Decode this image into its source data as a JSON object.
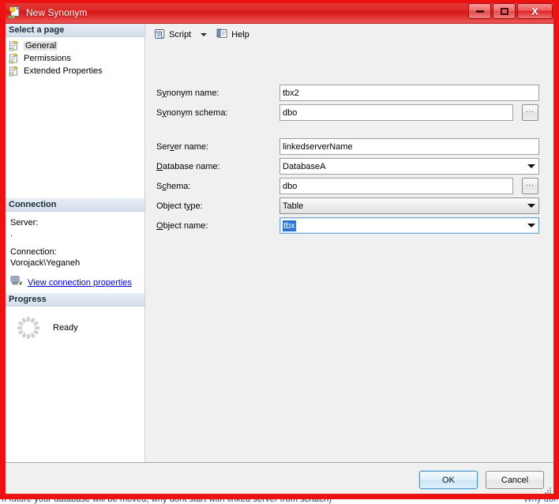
{
  "window": {
    "title": "New Synonym",
    "icon": "synonym-icon",
    "controls": {
      "minimize": "minimize",
      "maximize": "maximize",
      "close": "X"
    }
  },
  "sidebar": {
    "header": "Select a page",
    "items": [
      {
        "label": "General",
        "icon": "page-icon",
        "selected": true
      },
      {
        "label": "Permissions",
        "icon": "page-icon",
        "selected": false
      },
      {
        "label": "Extended Properties",
        "icon": "page-icon",
        "selected": false
      }
    ],
    "connection": {
      "header": "Connection",
      "server_label": "Server:",
      "server_value": ".",
      "connection_label": "Connection:",
      "connection_value": "Vorojack\\Yeganeh",
      "link_text": "View connection properties",
      "link_icon": "server-connection-icon"
    },
    "progress": {
      "header": "Progress",
      "status": "Ready",
      "spinner_icon": "progress-spinner-icon"
    }
  },
  "toolbar": {
    "script_label": "Script",
    "script_icon": "script-icon",
    "script_caret": "chevron-down-icon",
    "help_label": "Help",
    "help_icon": "help-icon"
  },
  "form": {
    "rows": [
      {
        "label_pre": "S",
        "label_key": "y",
        "label_post": "nonym name:",
        "value": "tbx2",
        "type": "text",
        "browse": false
      },
      {
        "label_pre": "S",
        "label_key": "y",
        "label_post": "nonym schema:",
        "value": "dbo",
        "type": "text",
        "browse": true
      },
      {
        "label_pre": "Ser",
        "label_key": "v",
        "label_post": "er name:",
        "value": "linkedserverName",
        "type": "text",
        "browse": false
      },
      {
        "label_pre": "",
        "label_key": "D",
        "label_post": "atabase name:",
        "value": "DatabaseA",
        "type": "combo",
        "browse": false
      },
      {
        "label_pre": "S",
        "label_key": "c",
        "label_post": "hema:",
        "value": "dbo",
        "type": "text",
        "browse": true
      },
      {
        "label_pre": "Object t",
        "label_key": "y",
        "label_post": "pe:",
        "value": "Table",
        "type": "combo-grey",
        "browse": false
      },
      {
        "label_pre": "",
        "label_key": "O",
        "label_post": "bject name:",
        "value": "tbx",
        "type": "combo-focused",
        "browse": false
      }
    ]
  },
  "buttons": {
    "ok": "OK",
    "cancel": "Cancel",
    "resize_grip": "resize-grip-icon"
  },
  "background": {
    "bleed_text": "n future your database will be moved, why dont start with linked server from scratch)",
    "bleed_link": "Why dont the difference matter...?"
  },
  "colors": {
    "titlebar_red": "#e02424",
    "annotation_red": "#ee1111",
    "selection_blue": "#2a72d4",
    "link_blue": "#0000cc",
    "dialog_face": "#f0f0f0"
  }
}
